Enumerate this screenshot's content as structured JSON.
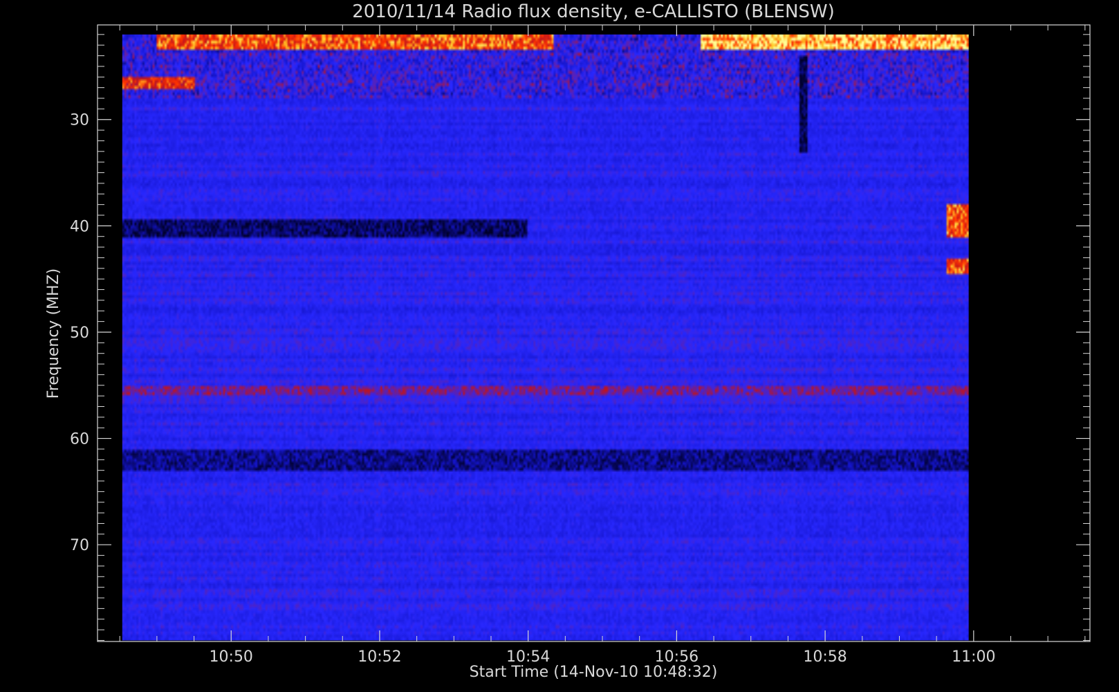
{
  "chart_data": {
    "type": "heatmap",
    "title": "2010/11/14  Radio flux density, e-CALLISTO (BLENSW)",
    "xlabel": "Start Time (14-Nov-10 10:48:32)",
    "ylabel": "Frequency (MHZ)",
    "x_ticks": [
      "10:50",
      "10:52",
      "10:54",
      "10:56",
      "10:58",
      "11:00"
    ],
    "x_tick_minutes": [
      50,
      52,
      54,
      56,
      58,
      60
    ],
    "y_ticks": [
      "30",
      "40",
      "50",
      "60",
      "70"
    ],
    "y_tick_values": [
      30,
      40,
      50,
      60,
      70
    ],
    "xlim": [
      "10:48:12",
      "11:01:34"
    ],
    "ylim": [
      79.1,
      21.1
    ],
    "data_x_range": [
      "10:48:32",
      "10:59:56"
    ],
    "data_y_range": [
      79.0,
      22.0
    ],
    "y_inverted": true,
    "colormap": "blue-red-yellow",
    "colors": {
      "background": "#000000",
      "axis": "#d8d8d8",
      "low": "#000050",
      "mid": "#2020ff",
      "high": "#ff2000",
      "peak": "#ffff80"
    },
    "features": [
      {
        "desc": "bright burst band",
        "freq_mhz": [
          22,
          23.5
        ],
        "time": [
          "10:49:00",
          "10:54:20"
        ],
        "level": 0.85
      },
      {
        "desc": "bright burst band",
        "freq_mhz": [
          22,
          23.5
        ],
        "time": [
          "10:56:20",
          "10:59:56"
        ],
        "level": 0.95
      },
      {
        "desc": "enhanced band",
        "freq_mhz": [
          26,
          27
        ],
        "time": [
          "10:48:32",
          "10:49:30"
        ],
        "level": 0.8
      },
      {
        "desc": "dark band",
        "freq_mhz": [
          39.5,
          41
        ],
        "time": [
          "10:48:32",
          "10:54:00"
        ],
        "level": 0.1
      },
      {
        "desc": "reddish band",
        "freq_mhz": [
          55,
          56
        ],
        "time": [
          "10:48:32",
          "10:59:56"
        ],
        "level": 0.6
      },
      {
        "desc": "dark striped band",
        "freq_mhz": [
          61,
          63
        ],
        "time": [
          "10:48:32",
          "10:59:56"
        ],
        "level": 0.15
      },
      {
        "desc": "bright spot",
        "freq_mhz": [
          38,
          41
        ],
        "time": [
          "10:59:38",
          "10:59:56"
        ],
        "level": 0.85
      },
      {
        "desc": "bright spot",
        "freq_mhz": [
          43,
          44.5
        ],
        "time": [
          "10:59:38",
          "10:59:56"
        ],
        "level": 0.85
      },
      {
        "desc": "dark streak",
        "freq_mhz": [
          24,
          33
        ],
        "time": [
          "10:57:40",
          "10:57:45"
        ],
        "level": 0.05
      }
    ]
  }
}
